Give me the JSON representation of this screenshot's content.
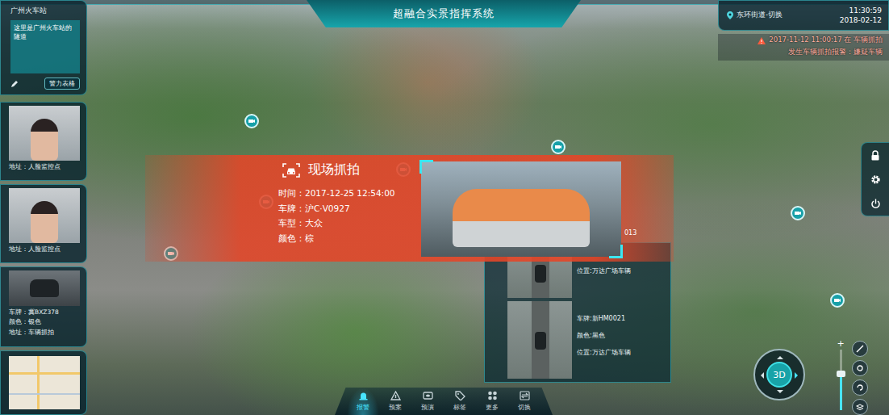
{
  "header": {
    "title": "超融合实景指挥系统"
  },
  "location_panel": {
    "title": "广州火车站",
    "description": "这里是广州火车站的隧道",
    "button": "警力表格"
  },
  "side_cards": [
    {
      "kind": "face",
      "lines": [
        "地址：人脸监控点"
      ]
    },
    {
      "kind": "face",
      "lines": [
        "地址：人脸监控点"
      ]
    },
    {
      "kind": "vehicle",
      "lines": [
        "车牌：冀BXZ378",
        "颜色：银色",
        "地址：车辆抓拍"
      ]
    },
    {
      "kind": "map",
      "lines": []
    }
  ],
  "status": {
    "district": "东环街道-切换",
    "time": "11:30:59",
    "date": "2018-02-12"
  },
  "alert": {
    "lines": [
      "2017-11-12 11:00:17 在 车辆抓拍",
      "发生车辆抓拍报警：嫌疑车辆"
    ]
  },
  "capture_popup": {
    "title": "现场抓拍",
    "fields": [
      "时间：2017-12-25 12:54:00",
      "车牌：沪C·V0927",
      "车型：大众",
      "颜色：棕"
    ]
  },
  "video_panel": {
    "fragment": "013",
    "feeds": [
      {
        "lines": [
          "位置:万达广场车辆"
        ]
      },
      {
        "lines": [
          "车牌:新HM0021",
          "颜色:黑色",
          "位置:万达广场车辆"
        ]
      }
    ]
  },
  "toolbar": [
    {
      "label": "报警",
      "selected": true
    },
    {
      "label": "预案",
      "selected": false
    },
    {
      "label": "预演",
      "selected": false
    },
    {
      "label": "标签",
      "selected": false
    },
    {
      "label": "更多",
      "selected": false
    },
    {
      "label": "切换",
      "selected": false
    }
  ],
  "map_controls": {
    "mode": "3D",
    "zoom_label": "+",
    "level": 0.6
  }
}
